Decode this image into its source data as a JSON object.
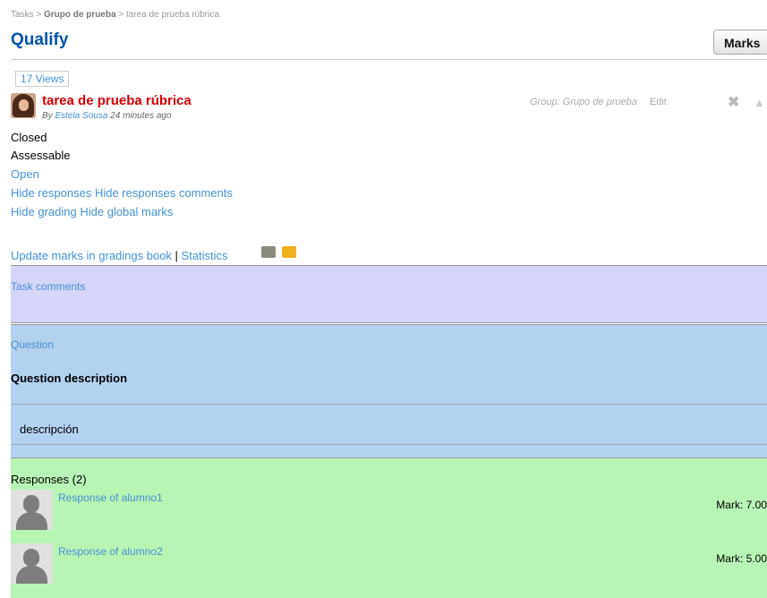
{
  "breadcrumb": {
    "tasks": "Tasks",
    "sep1": " > ",
    "group": "Grupo de prueba",
    "sep2": " > ",
    "task": "tarea de prueba rúbrica"
  },
  "page_title": "Qualify",
  "marks_button": "Marks",
  "views": "17 Views",
  "task": {
    "title": "tarea de prueba rúbrica",
    "by": "By ",
    "author": "Estela Sousa",
    "time": " 24 minutes ago"
  },
  "meta": {
    "group": "Group: Grupo de prueba",
    "edit": "Edit"
  },
  "status": {
    "closed": "Closed",
    "assessable": "Assessable"
  },
  "links": {
    "open": "Open",
    "hide_responses": "Hide responses",
    "hide_responses_comments": "Hide responses comments",
    "hide_grading": "Hide grading",
    "hide_global_marks": "Hide global marks",
    "update_marks": "Update marks in gradings book",
    "sep": " | ",
    "statistics": "Statistics"
  },
  "task_comments": "Task comments",
  "question": {
    "label": "Question",
    "desc_title": "Question description",
    "desc": "descripción"
  },
  "responses": {
    "title": "Responses (2)",
    "items": [
      {
        "label": "Response of alumno1",
        "mark": "Mark: 7.00"
      },
      {
        "label": "Response of alumno2",
        "mark": "Mark: 5.00"
      }
    ]
  },
  "icons": {
    "delete": "delete-icon",
    "like": "thumbs-up-icon",
    "book1": "grey-book-icon",
    "book2": "orange-book-icon"
  }
}
